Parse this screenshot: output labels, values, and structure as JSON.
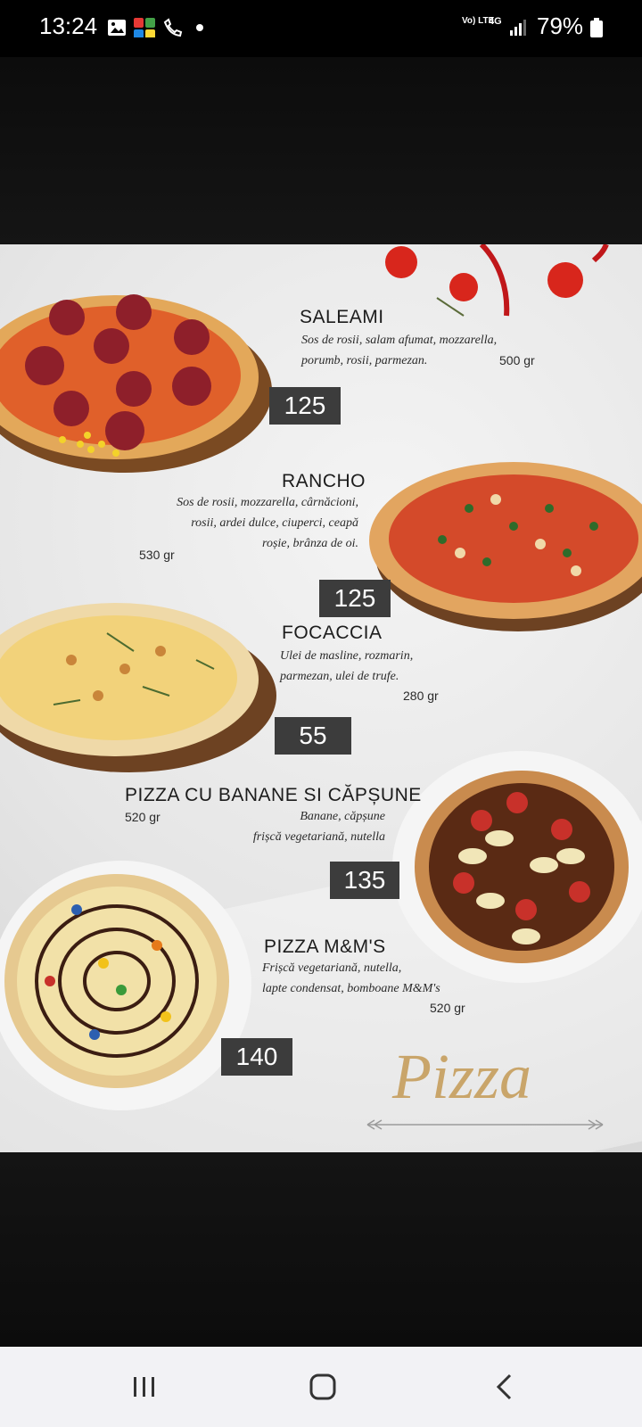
{
  "status_bar": {
    "time": "13:24",
    "network": "Vo) LTE",
    "signal_type": "4G",
    "battery": "79%",
    "icons": [
      "image-icon",
      "app-grid-icon",
      "missed-call-icon",
      "dot-icon",
      "volte-icon",
      "signal-icon",
      "battery-icon"
    ]
  },
  "menu": {
    "items": [
      {
        "title": "SALEAMI",
        "description_lines": [
          "Sos de rosii, salam afumat, mozzarella,",
          "porumb, rosii, parmezan."
        ],
        "weight": "500 gr",
        "price": "125"
      },
      {
        "title": "RANCHO",
        "description_lines": [
          "Sos de rosii, mozzarella, cârnăcioni,",
          "rosii, ardei dulce, ciuperci, ceapă",
          "roșie, brânza de oi."
        ],
        "weight": "530 gr",
        "price": "125"
      },
      {
        "title": "FOCACCIA",
        "description_lines": [
          "Ulei de masline, rozmarin,",
          "parmezan, ulei de trufe."
        ],
        "weight": "280 gr",
        "price": "55"
      },
      {
        "title": "PIZZA CU BANANE SI CĂPȘUNE",
        "description_lines": [
          "Banane, căpșune",
          "frișcă vegetariană, nutella"
        ],
        "weight": "520 gr",
        "price": "135"
      },
      {
        "title": "PIZZA M&M'S",
        "description_lines": [
          "Frișcă vegetariană, nutella,",
          "lapte condensat, bomboane M&M's"
        ],
        "weight": "520 gr",
        "price": "140"
      }
    ],
    "heading_script": "Pizza"
  },
  "colors": {
    "price_tag": "#3c3c3c",
    "gold": "#c9a56a",
    "tomato": "#d8261c"
  }
}
